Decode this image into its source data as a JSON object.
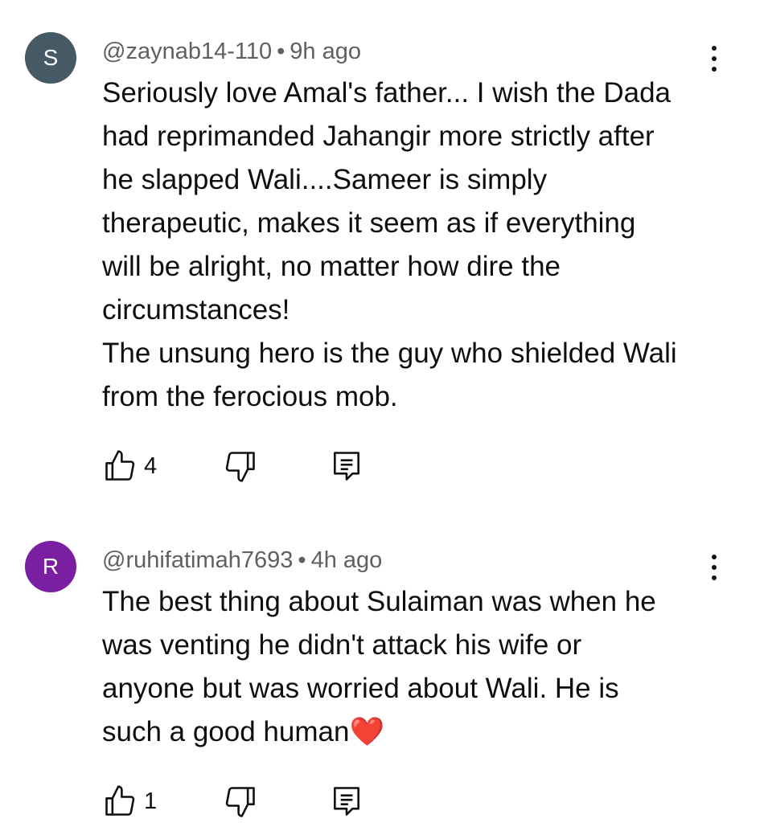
{
  "comments": [
    {
      "avatar_letter": "S",
      "avatar_color": "#455a64",
      "author": "@zaynab14-110",
      "separator": "•",
      "time": "9h ago",
      "lines": [
        "Seriously love Amal's father... I wish the Dada",
        "had reprimanded Jahangir more strictly after",
        "he slapped Wali....Sameer is simply",
        "therapeutic, makes it seem as if everything",
        "will be alright, no matter how dire the",
        "circumstances!",
        "The unsung hero is the guy who shielded Wali",
        "from the ferocious mob."
      ],
      "like_count": "4",
      "icons": {
        "like": "thumbs-up-icon",
        "dislike": "thumbs-down-icon",
        "reply": "reply-icon",
        "more": "more-vert-icon"
      }
    },
    {
      "avatar_letter": "R",
      "avatar_color": "#7b1fa2",
      "author": "@ruhifatimah7693",
      "separator": "•",
      "time": "4h ago",
      "lines": [
        "The best thing about Sulaiman was when he",
        "was venting he didn't attack his wife or",
        "anyone but was worried about Wali. He is"
      ],
      "last_line": "such a good human",
      "emoji": "❤️",
      "like_count": "1",
      "icons": {
        "like": "thumbs-up-icon",
        "dislike": "thumbs-down-icon",
        "reply": "reply-icon",
        "more": "more-vert-icon"
      }
    }
  ]
}
